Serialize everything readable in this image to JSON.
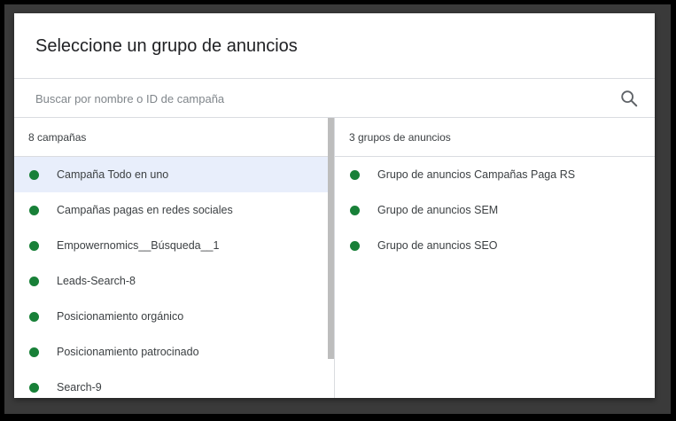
{
  "dialog": {
    "title": "Seleccione un grupo de anuncios"
  },
  "search": {
    "placeholder": "Buscar por nombre o ID de campaña",
    "value": "",
    "icon": "search-icon"
  },
  "campaigns": {
    "header": "8 campañas",
    "selected_index": 0,
    "items": [
      {
        "label": "Campaña Todo en uno",
        "status_color": "#188038"
      },
      {
        "label": "Campañas pagas en redes sociales",
        "status_color": "#188038"
      },
      {
        "label": "Empowernomics__Búsqueda__1",
        "status_color": "#188038"
      },
      {
        "label": "Leads-Search-8",
        "status_color": "#188038"
      },
      {
        "label": "Posicionamiento orgánico",
        "status_color": "#188038"
      },
      {
        "label": "Posicionamiento patrocinado",
        "status_color": "#188038"
      },
      {
        "label": "Search-9",
        "status_color": "#188038"
      }
    ]
  },
  "ad_groups": {
    "header": "3 grupos de anuncios",
    "items": [
      {
        "label": "Grupo de anuncios Campañas Paga RS",
        "status_color": "#188038"
      },
      {
        "label": "Grupo de anuncios SEM",
        "status_color": "#188038"
      },
      {
        "label": "Grupo de anuncios SEO",
        "status_color": "#188038"
      }
    ]
  },
  "colors": {
    "selected_row": "#e8eefb",
    "status_enabled": "#188038",
    "divider": "#dadce0"
  }
}
